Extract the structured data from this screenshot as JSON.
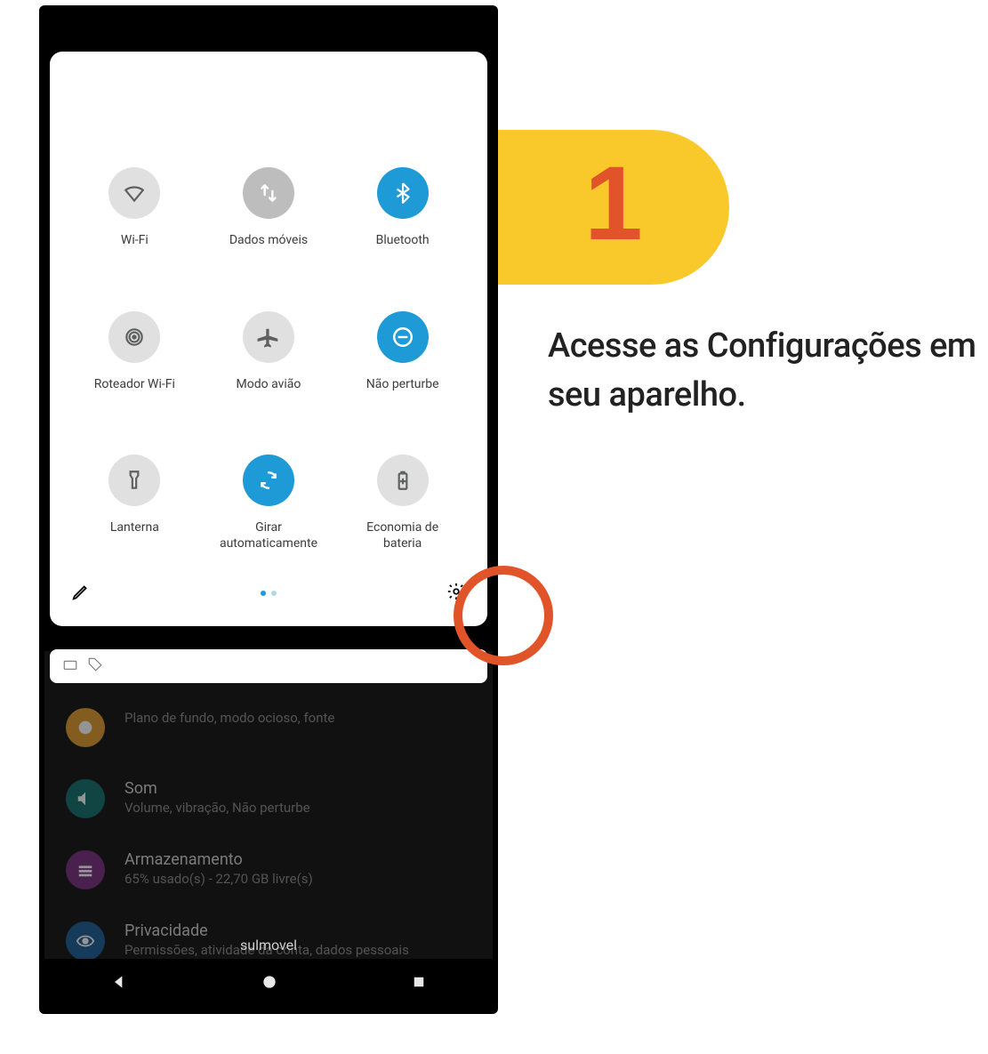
{
  "step": {
    "number": "1",
    "instruction": "Acesse as Configurações em seu aparelho."
  },
  "quick_settings": {
    "tiles": [
      {
        "label": "Wi-Fi",
        "active": false,
        "icon": "wifi"
      },
      {
        "label": "Dados móveis",
        "active": false,
        "icon": "data",
        "grey": true
      },
      {
        "label": "Bluetooth",
        "active": true,
        "icon": "bt"
      },
      {
        "label": "Roteador Wi-Fi",
        "active": false,
        "icon": "hotspot"
      },
      {
        "label": "Modo avião",
        "active": false,
        "icon": "airplane"
      },
      {
        "label": "Não perturbe",
        "active": true,
        "icon": "dnd"
      },
      {
        "label": "Lanterna",
        "active": false,
        "icon": "flash"
      },
      {
        "label": "Girar\nautomaticamente",
        "active": true,
        "icon": "rotate"
      },
      {
        "label": "Economia de\nbateria",
        "active": false,
        "icon": "battery"
      }
    ]
  },
  "background_settings": {
    "rows": [
      {
        "title": "",
        "sub": "Plano de fundo, modo ocioso, fonte",
        "color": "#e09a2e"
      },
      {
        "title": "Som",
        "sub": "Volume, vibração, Não perturbe",
        "color": "#12706e"
      },
      {
        "title": "Armazenamento",
        "sub": "65% usado(s) - 22,70 GB livre(s)",
        "color": "#7a2d82"
      },
      {
        "title": "Privacidade",
        "sub": "Permissões, atividade da conta, dados pessoais",
        "color": "#1b5d96"
      }
    ]
  },
  "carrier": "sulmovel"
}
